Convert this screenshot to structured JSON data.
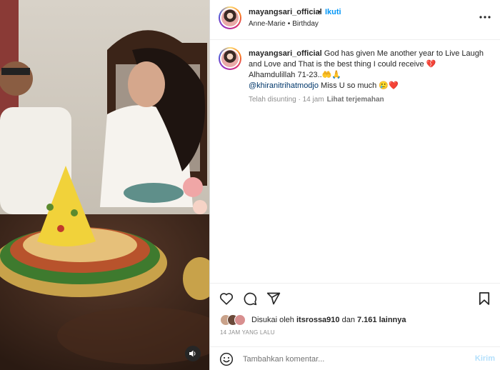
{
  "header": {
    "username": "mayangsari_official",
    "dot": "•",
    "follow_label": "Ikuti",
    "audio_label": "Anne-Marie",
    "separator": "•",
    "song_label": "Birthday"
  },
  "caption": {
    "username": "mayangsari_official",
    "text_line1": " God has given Me another year to Live Laugh and Love and That is the best thing I could receive ",
    "emoji1": "💔",
    "text_line2": "Alhamdulillah 71-23..",
    "emoji2": "🤲🙏",
    "mention": "@khiranitrihatmodjo",
    "text_line3": " Miss U so much ",
    "emoji3": "🥲❤️",
    "edited_label": "Telah disunting · 14 jam",
    "translate_label": "Lihat terjemahan"
  },
  "actions": {
    "like_icon": "heart-icon",
    "comment_icon": "comment-icon",
    "share_icon": "share-icon",
    "save_icon": "bookmark-icon"
  },
  "likes": {
    "prefix": "Disukai oleh ",
    "liker": "itsrossa910",
    "middle": " dan ",
    "count": "7.161 lainnya"
  },
  "time_ago": "14 JAM YANG LALU",
  "comment": {
    "placeholder": "Tambahkan komentar...",
    "send_label": "Kirim"
  },
  "colors": {
    "accent": "#0095f6",
    "send_disabled": "#b2dffc",
    "tumpeng": "#f1d23a"
  }
}
